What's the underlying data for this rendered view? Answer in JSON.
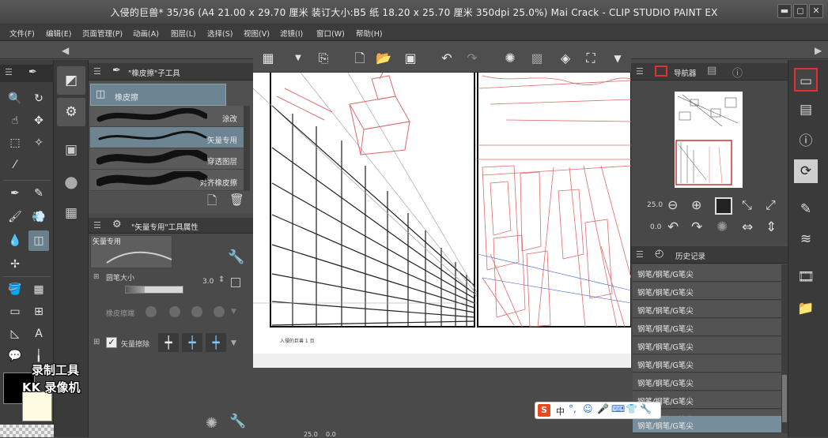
{
  "window": {
    "title": "入侵的巨兽* 35/36 (A4 21.00 x 29.70 厘米 装订大小:B5 纸 18.20 x 25.70 厘米 350dpi 25.0%)   Mai Crack - CLIP STUDIO PAINT EX",
    "min_label": "▬",
    "max_label": "◻",
    "close_label": "✕"
  },
  "menu": {
    "items": [
      "文件(F)",
      "编辑(E)",
      "页面管理(P)",
      "动画(A)",
      "图层(L)",
      "选择(S)",
      "视图(V)",
      "滤镜(I)",
      "窗口(W)",
      "帮助(H)"
    ]
  },
  "subtool_panel": {
    "title": "\"橡皮擦\"子工具",
    "tab_label": "橡皮擦",
    "brushes": [
      {
        "label": "涂改"
      },
      {
        "label": "矢量专用"
      },
      {
        "label": "穿透图层"
      },
      {
        "label": "对齐橡皮擦"
      }
    ],
    "selected_index": 1
  },
  "tool_property": {
    "title": "\"矢量专用\"工具属性",
    "preview_label": "矢量专用",
    "size_label": "圆笔大小",
    "size_value": "3.0",
    "tip_label": "橡皮擦端",
    "vector_label": "矢量擦除",
    "vector_checked": true
  },
  "canvas": {
    "page_label": "入侵的巨兽 1 页",
    "status_zoom": "25.0",
    "status_angle": "0.0"
  },
  "navigator": {
    "title": "导航器",
    "zoom_value": "25.0",
    "angle_value": "0.0"
  },
  "history": {
    "title": "历史记录",
    "items": [
      "钢笔/钢笔/G笔尖",
      "钢笔/钢笔/G笔尖",
      "钢笔/钢笔/G笔尖",
      "钢笔/钢笔/G笔尖",
      "钢笔/钢笔/G笔尖",
      "钢笔/钢笔/G笔尖",
      "钢笔/钢笔/G笔尖",
      "钢笔/钢笔/G笔尖",
      "钢笔/钢笔/G笔尖",
      "钢笔/钢笔/G笔尖",
      "钢笔/钢笔/G笔尖"
    ]
  },
  "watermark": {
    "line1": "录制工具",
    "line2": "KK 录像机"
  },
  "ime": {
    "label": "中",
    "logo": "S"
  },
  "colors": {
    "accent": "#6d8592",
    "history_selected": "#768d9b",
    "perspective_red": "#e06a6a",
    "main_color": "#000000",
    "sub_color": "#fffbe0"
  }
}
